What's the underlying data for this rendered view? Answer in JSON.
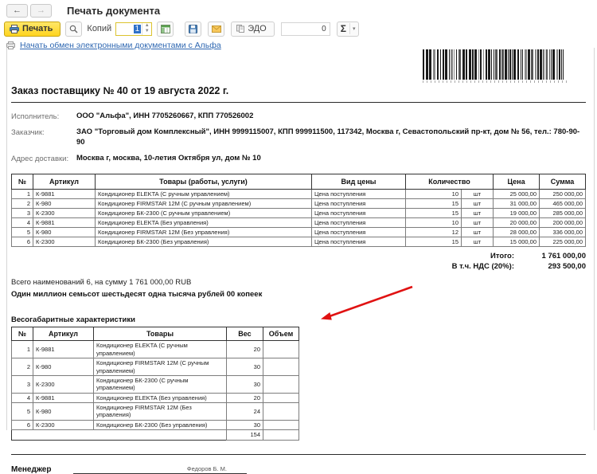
{
  "nav": {
    "back": "←",
    "forward": "→",
    "title": "Печать документа"
  },
  "toolbar": {
    "print_label": "Печать",
    "copies_label": "Копий",
    "copies_value": "1",
    "edo_label": "ЭДО",
    "counter_value": "0",
    "sum_label": "Σ",
    "chevron": "▾"
  },
  "link": {
    "label": "Начать обмен электронными документами с Альфа"
  },
  "document": {
    "title": "Заказ поставщику № 40 от 19 августа 2022 г.",
    "fields": [
      {
        "label": "Исполнитель:",
        "value": "ООО \"Альфа\", ИНН 7705260667, КПП 770526002"
      },
      {
        "label": "Заказчик:",
        "value": "ЗАО \"Торговый дом Комплексный\", ИНН 9999115007, КПП 999911500, 117342, Москва г, Севастопольский пр-кт, дом № 56, тел.: 780-90-90"
      },
      {
        "label": "Адрес доставки:",
        "value": "Москва г, москва, 10-летия Октября ул, дом № 10"
      }
    ],
    "goods_table": {
      "headers": [
        "№",
        "Артикул",
        "Товары (работы, услуги)",
        "Вид цены",
        "Количество",
        "Цена",
        "Сумма"
      ],
      "rows": [
        [
          "1",
          "К-9881",
          "Кондиционер ELEKTA (С ручным управлением)",
          "Цена поступления",
          "10",
          "шт",
          "25 000,00",
          "250 000,00"
        ],
        [
          "2",
          "К-980",
          "Кондиционер FIRMSTAR 12М (С ручным управлением)",
          "Цена поступления",
          "15",
          "шт",
          "31 000,00",
          "465 000,00"
        ],
        [
          "3",
          "К-2300",
          "Кондиционер БК-2300 (С ручным управлением)",
          "Цена поступления",
          "15",
          "шт",
          "19 000,00",
          "285 000,00"
        ],
        [
          "4",
          "К-9881",
          "Кондиционер ELEKTA (Без управления)",
          "Цена поступления",
          "10",
          "шт",
          "20 000,00",
          "200 000,00"
        ],
        [
          "5",
          "К-980",
          "Кондиционер FIRMSTAR 12М (Без управления)",
          "Цена поступления",
          "12",
          "шт",
          "28 000,00",
          "336 000,00"
        ],
        [
          "6",
          "К-2300",
          "Кондиционер БК-2300 (Без управления)",
          "Цена поступления",
          "15",
          "шт",
          "15 000,00",
          "225 000,00"
        ]
      ]
    },
    "totals": {
      "total_label": "Итого:",
      "total_value": "1 761 000,00",
      "vat_label": "В т.ч. НДС (20%):",
      "vat_value": "293 500,00"
    },
    "summary_line": "Всего наименований 6, на сумму 1 761 000,00 RUB",
    "amount_in_words": "Один миллион семьсот шестьдесят одна тысяча рублей 00 копеек",
    "weight_section": {
      "title": "Весогабаритные характеристики",
      "headers": [
        "№",
        "Артикул",
        "Товары",
        "Вес",
        "Объем"
      ],
      "rows": [
        [
          "1",
          "К-9881",
          "Кондиционер ELEKTA (С ручным управлением)",
          "20",
          ""
        ],
        [
          "2",
          "К-980",
          "Кондиционер FIRMSTAR 12М (С ручным управлением)",
          "30",
          ""
        ],
        [
          "3",
          "К-2300",
          "Кондиционер БК-2300 (С ручным управлением)",
          "30",
          ""
        ],
        [
          "4",
          "К-9881",
          "Кондиционер ELEKTA (Без управления)",
          "20",
          ""
        ],
        [
          "5",
          "К-980",
          "Кондиционер FIRMSTAR 12М (Без управления)",
          "24",
          ""
        ],
        [
          "6",
          "К-2300",
          "Кондиционер БК-2300 (Без управления)",
          "30",
          ""
        ]
      ],
      "total_weight": "154"
    },
    "footer": {
      "manager_label": "Менеджер",
      "manager_name": "Федоров Б. М."
    }
  },
  "colors": {
    "accent_yellow": "#ffd41f",
    "link_blue": "#2e67b1",
    "arrow_red": "#e01212"
  }
}
